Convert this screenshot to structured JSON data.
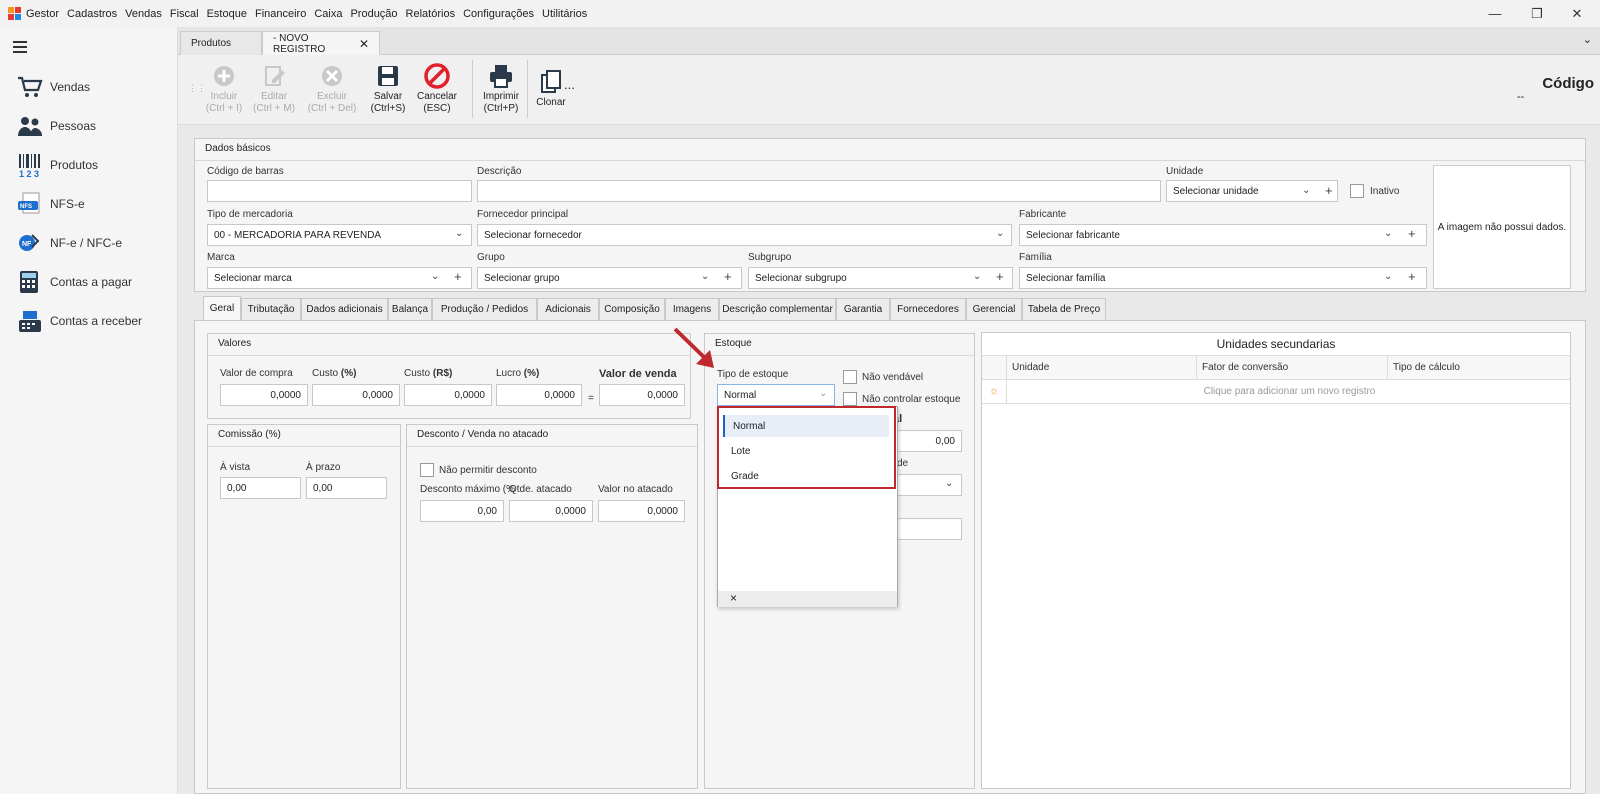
{
  "app": {
    "name": "Gestor",
    "menu": [
      "Cadastros",
      "Vendas",
      "Fiscal",
      "Estoque",
      "Financeiro",
      "Caixa",
      "Produção",
      "Relatórios",
      "Configurações",
      "Utilitários"
    ]
  },
  "sidebar": {
    "items": [
      {
        "label": "Vendas",
        "icon": "cart-icon"
      },
      {
        "label": "Pessoas",
        "icon": "people-icon"
      },
      {
        "label": "Produtos",
        "icon": "barcode-icon"
      },
      {
        "label": "NFS-e",
        "icon": "nfse-icon"
      },
      {
        "label": "NF-e / NFC-e",
        "icon": "nfe-icon"
      },
      {
        "label": "Contas a pagar",
        "icon": "calculator-icon"
      },
      {
        "label": "Contas a receber",
        "icon": "cash-register-icon"
      }
    ]
  },
  "doc_tabs": [
    {
      "label": "Produtos"
    },
    {
      "label": "- NOVO REGISTRO"
    }
  ],
  "toolbar": {
    "incluir": "Incluir",
    "incluir_sc": "(Ctrl + I)",
    "editar": "Editar",
    "editar_sc": "(Ctrl + M)",
    "excluir": "Excluir",
    "excluir_sc": "(Ctrl + Del)",
    "salvar": "Salvar",
    "salvar_sc": "(Ctrl+S)",
    "cancelar": "Cancelar",
    "cancelar_sc": "(ESC)",
    "imprimir": "Imprimir",
    "imprimir_sc": "(Ctrl+P)",
    "clonar": "Clonar",
    "more": "...",
    "codigo_label": "Código",
    "codigo_value": "--"
  },
  "dados": {
    "title": "Dados básicos",
    "codigo_barras": "Código de barras",
    "descricao": "Descrição",
    "unidade": "Unidade",
    "unidade_val": "Selecionar unidade",
    "inativo": "Inativo",
    "tipo_merc": "Tipo de mercadoria",
    "tipo_merc_val": "00 - MERCADORIA PARA REVENDA",
    "fornecedor": "Fornecedor principal",
    "fornecedor_val": "Selecionar fornecedor",
    "fabricante": "Fabricante",
    "fabricante_val": "Selecionar fabricante",
    "marca": "Marca",
    "marca_val": "Selecionar marca",
    "grupo": "Grupo",
    "grupo_val": "Selecionar grupo",
    "subgrupo": "Subgrupo",
    "subgrupo_val": "Selecionar subgrupo",
    "familia": "Família",
    "familia_val": "Selecionar família",
    "imagem": "A imagem não possui dados."
  },
  "tabs": [
    "Geral",
    "Tributação",
    "Dados adicionais",
    "Balança",
    "Produção / Pedidos",
    "Adicionais",
    "Composição",
    "Imagens",
    "Descrição complementar",
    "Garantia",
    "Fornecedores",
    "Gerencial",
    "Tabela de Preço"
  ],
  "valores": {
    "title": "Valores",
    "compra": "Valor de compra",
    "custo_pct": "Custo",
    "custo_rs": "Custo",
    "lucro": "Lucro",
    "pct": "(%)",
    "rs": "(R$)",
    "venda": "Valor de venda",
    "v_compra": "0,0000",
    "v_custo_pct": "0,0000",
    "v_custo_rs": "0,0000",
    "v_lucro": "0,0000",
    "v_venda": "0,0000",
    "eq": "="
  },
  "comissao": {
    "title": "Comissão (%)",
    "vista": "À vista",
    "prazo": "À prazo",
    "v_vista": "0,00",
    "v_prazo": "0,00"
  },
  "desconto": {
    "title": "Desconto / Venda no atacado",
    "nao_permitir": "Não permitir desconto",
    "max": "Desconto máximo (%",
    "qtde": "Qtde. atacado",
    "valor": "Valor no atacado",
    "v_max": "0,00",
    "v_qtde": "0,0000",
    "v_valor": "0,0000"
  },
  "estoque": {
    "title": "Estoque",
    "tipo": "Tipo de estoque",
    "tipo_val": "Normal",
    "nao_vendavel": "Não vendável",
    "nao_controlar": "Não controlar estoque",
    "hidden_label": "al",
    "hidden_val": "0,00",
    "hidden_label2": "de",
    "options": [
      "Normal",
      "Lote",
      "Grade"
    ],
    "close": "×"
  },
  "unidades": {
    "title": "Unidades secundarias",
    "cols": [
      "Unidade",
      "Fator de conversão",
      "Tipo de cálculo"
    ],
    "new_row": "Clique para adicionar um novo registro"
  }
}
